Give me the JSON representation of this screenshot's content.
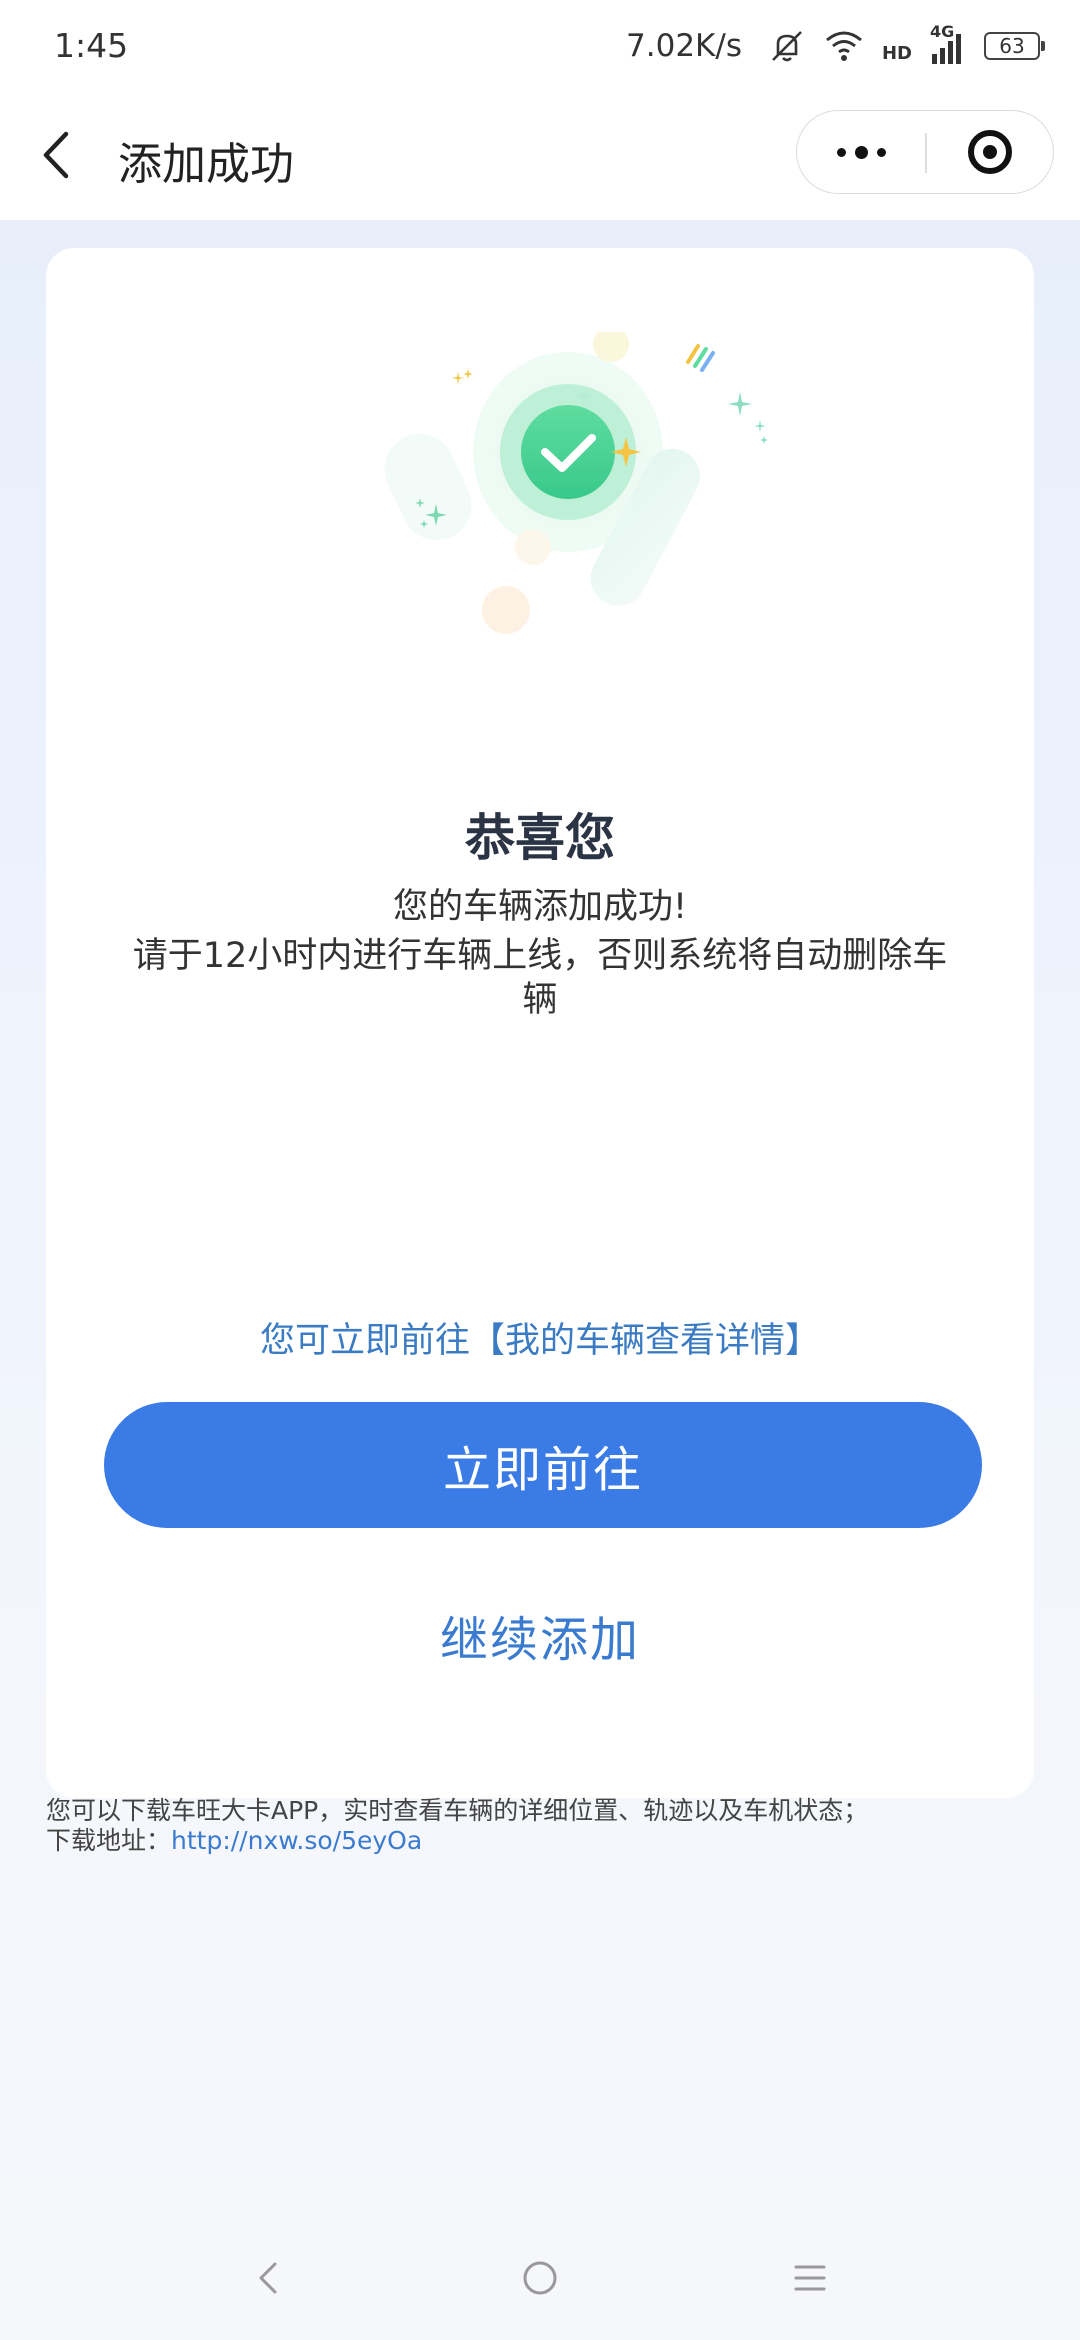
{
  "status_bar": {
    "time": "1:45",
    "net_speed": "7.02K/s",
    "signal_label": "4G",
    "hd_label": "HD",
    "battery": "63"
  },
  "nav": {
    "title": "添加成功",
    "icons": {
      "back": "back-arrow-icon",
      "more": "more-dots-icon",
      "close": "target-close-icon"
    }
  },
  "card": {
    "title": "恭喜您",
    "success_text": "您的车辆添加成功!",
    "notice_text": "请于12小时内进行车辆上线，否则系统将自动删除车辆",
    "goto_hint": "您可立即前往【我的车辆查看详情】",
    "primary_button": "立即前往",
    "secondary_button": "继续添加"
  },
  "footer": {
    "line1": "您可以下载车旺大卡APP，实时查看车辆的详细位置、轨迹以及车机状态；",
    "line2_prefix": "下载地址：",
    "link": "http://nxw.so/5eyOa"
  },
  "colors": {
    "primary": "#3a7be6",
    "link": "#3a7bd0",
    "success_green": "#4fd596"
  }
}
